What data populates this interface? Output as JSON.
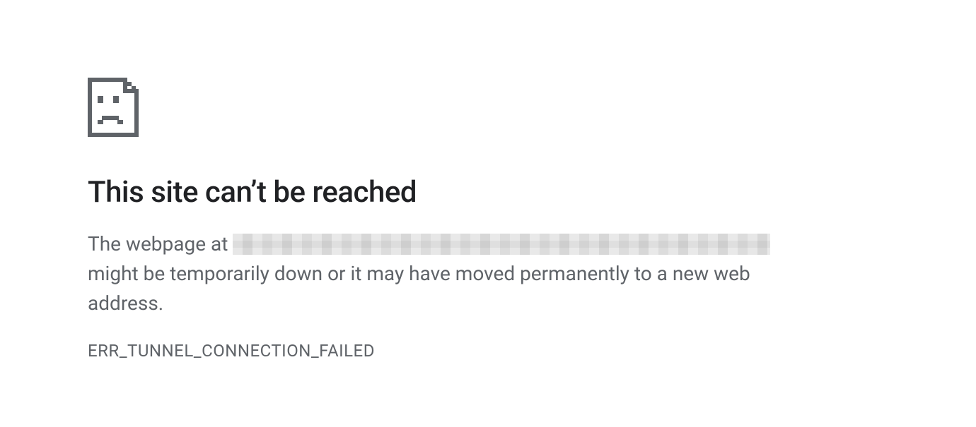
{
  "error": {
    "heading": "This site can’t be reached",
    "desc_prefix": "The webpage at ",
    "desc_suffix": " might be temporarily down or it may have moved permanently to a new web address.",
    "code": "ERR_TUNNEL_CONNECTION_FAILED",
    "icon": "sad-page-icon"
  }
}
